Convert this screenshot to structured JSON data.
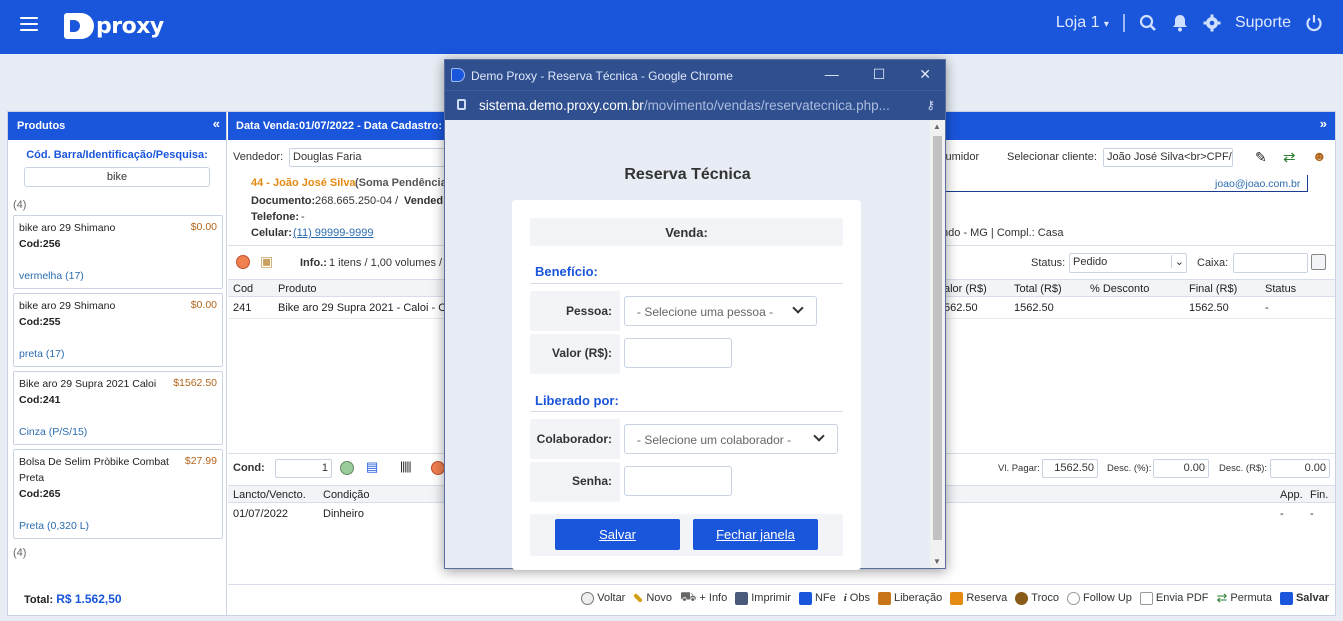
{
  "topbar": {
    "logo_text": "proxy",
    "store": "Loja 1",
    "support": "Suporte",
    "icons": [
      "menu-icon",
      "search-icon",
      "bell-icon",
      "gear-icon",
      "power-icon"
    ]
  },
  "left": {
    "title": "Produtos",
    "search_label": "Cód. Barra/Identificação/Pesquisa:",
    "search_value": "bike",
    "count_top": "(4)",
    "count_bottom": "(4)",
    "products": [
      {
        "name": "bike aro 29 Shimano",
        "price": "$0.00",
        "code": "Cod:256",
        "variant": "vermelha (17)"
      },
      {
        "name": "bike aro 29 Shimano",
        "price": "$0.00",
        "code": "Cod:255",
        "variant": "preta (17)"
      },
      {
        "name": "Bike aro 29 Supra 2021 Caloi",
        "price": "$1562.50",
        "code": "Cod:241",
        "variant": "Cinza (P/S/15)"
      },
      {
        "name": "Bolsa De Selim Pròbike Combat Preta",
        "price": "$27.99",
        "code": "Cod:265",
        "variant": "Preta (0,320 L)"
      }
    ],
    "total_label": "Total:",
    "total_value": "R$ 1.562,50"
  },
  "right": {
    "header": "Data Venda:01/07/2022 - Data Cadastro:",
    "vendedor_label": "Vendedor:",
    "vendedor_value": "Douglas Faria",
    "consumidor_label": "sumidor",
    "selecionar_label": "Selecionar cliente:",
    "cliente_value": "João José Silva<br>CPF/(",
    "email": "joao@joao.com.br",
    "client_line": "44 - João José Silva",
    "client_note": "(Soma Pendência",
    "doc_label": "Documento:",
    "doc_value": "268.665.250-04 /",
    "vendedor_b": "Vended",
    "tel_label": "Telefone:",
    "tel_value": "-",
    "cel_label": "Celular:",
    "cel_value": "(11) 99999-9999",
    "address": "ndo - MG | Compl.: Casa",
    "info_label": "Info.:",
    "info_value": "1 itens / 1,00 volumes / V",
    "status_label": "Status:",
    "status_value": "Pedido",
    "caixa_label": "Caixa:",
    "columns": [
      "Cod",
      "Produto",
      "alor (R$)",
      "Total (R$)",
      "% Desconto",
      "Final (R$)",
      "Status"
    ],
    "row": {
      "cod": "241",
      "produto": "Bike aro 29 Supra 2021 - Caloi - Ci",
      "valor": "562.50",
      "total": "1562.50",
      "desc": "",
      "final": "1562.50",
      "status": "-"
    },
    "cond_label": "Cond:",
    "cond_value": "1",
    "vl_pagar_label": "Vl. Pagar:",
    "vl_pagar_value": "1562.50",
    "desc_pct_label": "Desc. (%):",
    "desc_pct_value": "0.00",
    "desc_rs_label": "Desc. (R$):",
    "desc_rs_value": "0.00",
    "pay_columns": [
      "Lancto/Vencto.",
      "Condição",
      "App.",
      "Fin."
    ],
    "pay_row": {
      "date": "01/07/2022",
      "cond": "Dinheiro",
      "app": "-",
      "fin": "-"
    }
  },
  "footer": [
    {
      "label": "Voltar",
      "icon": "back-icon",
      "color": "#777777"
    },
    {
      "label": "Novo",
      "icon": "wand-icon",
      "color": "#d4a017"
    },
    {
      "label": "+ Info",
      "icon": "cart-icon",
      "color": "#666666"
    },
    {
      "label": "Imprimir",
      "icon": "printer-icon",
      "color": "#4a5a7a"
    },
    {
      "label": "NFe",
      "icon": "nfe-icon",
      "color": "#1a56db"
    },
    {
      "label": "Obs",
      "icon": "info-icon",
      "color": "#333333"
    },
    {
      "label": "Liberação",
      "icon": "tools-icon",
      "color": "#c8751a"
    },
    {
      "label": "Reserva",
      "icon": "reserve-icon",
      "color": "#e58a12"
    },
    {
      "label": "Troco",
      "icon": "coins-icon",
      "color": "#8a5a1a"
    },
    {
      "label": "Follow Up",
      "icon": "chat-icon",
      "color": "#999999"
    },
    {
      "label": "Envia PDF",
      "icon": "mail-icon",
      "color": "#999999"
    },
    {
      "label": "Permuta",
      "icon": "swap-icon",
      "color": "#2e7d32"
    },
    {
      "label": "Salvar",
      "icon": "save-icon",
      "color": "#1a56db"
    }
  ],
  "popup": {
    "window_title": "Demo Proxy - Reserva Técnica - Google Chrome",
    "url_host": "sistema.demo.proxy.com.br",
    "url_path": "/movimento/vendas/reservatecnica.php...",
    "title": "Reserva Técnica",
    "venda_label": "Venda:",
    "beneficio": "Benefício:",
    "pessoa_label": "Pessoa:",
    "pessoa_placeholder": "- Selecione uma pessoa -",
    "valor_label": "Valor (R$):",
    "liberado": "Liberado por:",
    "colaborador_label": "Colaborador:",
    "colaborador_placeholder": "- Selecione um colaborador -",
    "senha_label": "Senha:",
    "salvar": "Salvar",
    "fechar": "Fechar janela"
  }
}
